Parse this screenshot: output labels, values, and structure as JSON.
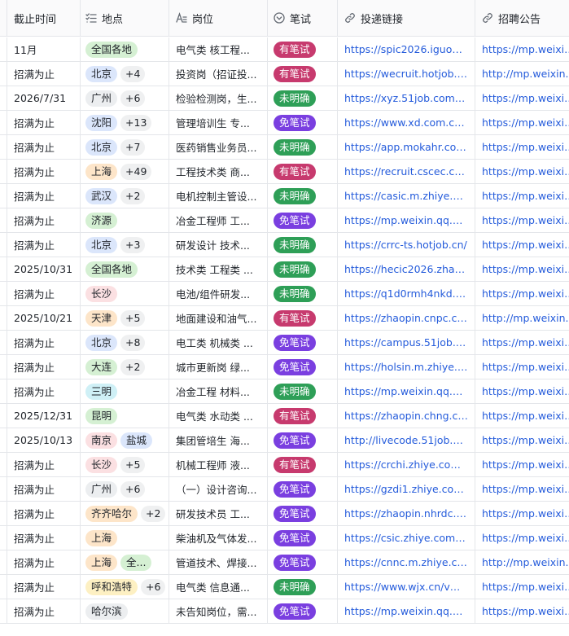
{
  "header": {
    "col_deadline": "截止时间",
    "col_location": "地点",
    "col_position": "岗位",
    "col_exam": "笔试",
    "col_apply": "投递链接",
    "col_notice": "招聘公告"
  },
  "colors": {
    "exam": {
      "有笔试": "#c73a6e",
      "未明确": "#2e9f57",
      "免笔试": "#7a3fe0"
    },
    "tags": {
      "全国各地": "#d5f0d3",
      "北京": "#dbe6fb",
      "广州": "#eceef0",
      "沈阳": "#dbe6fb",
      "上海": "#fde5c9",
      "武汉": "#dbe6fb",
      "济源": "#d5f0d3",
      "长沙": "#fbe0e2",
      "天津": "#fde5c9",
      "大连": "#d5f0d3",
      "三明": "#cff0f6",
      "昆明": "#d5f0d3",
      "南京": "#fbe0e2",
      "盐城": "#dbe6fb",
      "齐齐哈尔": "#fde5c9",
      "全...": "#d5f0d3",
      "呼和浩特": "#fdf0c3",
      "哈尔滨": "#eceef0"
    }
  },
  "rows": [
    {
      "deadline": "11月",
      "tags": [
        "全国各地"
      ],
      "more": "",
      "position": "电气类 核工程...",
      "exam": "有笔试",
      "apply": "https://spic2026.iguopin...",
      "notice": "https://mp.weixin..."
    },
    {
      "deadline": "招满为止",
      "tags": [
        "北京"
      ],
      "more": "+4",
      "position": "投资岗（招证投...",
      "exam": "有笔试",
      "apply": "https://wecruit.hotjob.c...",
      "notice": "http://mp.weixin.q..."
    },
    {
      "deadline": "2026/7/31",
      "tags": [
        "广州"
      ],
      "more": "+6",
      "position": "检验检测岗，生...",
      "exam": "未明确",
      "apply": "https://xyz.51job.com/c...",
      "notice": "https://mp.weixin..."
    },
    {
      "deadline": "招满为止",
      "tags": [
        "沈阳"
      ],
      "more": "+13",
      "position": "管理培训生 专...",
      "exam": "免笔试",
      "apply": "https://www.xd.com.cn/...",
      "notice": "https://mp.weixin..."
    },
    {
      "deadline": "招满为止",
      "tags": [
        "北京"
      ],
      "more": "+7",
      "position": "医药销售业务员...",
      "exam": "未明确",
      "apply": "https://app.mokahr.com...",
      "notice": "https://mp.weixin..."
    },
    {
      "deadline": "招满为止",
      "tags": [
        "上海"
      ],
      "more": "+49",
      "position": "工程技术类 商...",
      "exam": "有笔试",
      "apply": "https://recruit.cscec.co...",
      "notice": "https://mp.weixin..."
    },
    {
      "deadline": "招满为止",
      "tags": [
        "武汉"
      ],
      "more": "+2",
      "position": "电机控制主管设...",
      "exam": "未明确",
      "apply": "https://casic.m.zhiye.co...",
      "notice": "https://mp.weixin..."
    },
    {
      "deadline": "招满为止",
      "tags": [
        "济源"
      ],
      "more": "",
      "position": "冶金工程师 工...",
      "exam": "免笔试",
      "apply": "https://mp.weixin.qq.co...",
      "notice": "https://mp.weixin..."
    },
    {
      "deadline": "招满为止",
      "tags": [
        "北京"
      ],
      "more": "+3",
      "position": "研发设计 技术...",
      "exam": "未明确",
      "apply": "https://crrc-ts.hotjob.cn/",
      "notice": "https://mp.weixin..."
    },
    {
      "deadline": "2025/10/31",
      "tags": [
        "全国各地"
      ],
      "more": "",
      "position": "技术类 工程类 ...",
      "exam": "未明确",
      "apply": "https://hecic2026.zhaop...",
      "notice": "https://mp.weixin..."
    },
    {
      "deadline": "招满为止",
      "tags": [
        "长沙"
      ],
      "more": "",
      "position": "电池/组件研发...",
      "exam": "未明确",
      "apply": "https://q1d0rmh4nkd.fe...",
      "notice": "https://mp.weixin..."
    },
    {
      "deadline": "2025/10/21",
      "tags": [
        "天津"
      ],
      "more": "+5",
      "position": "地面建设和油气...",
      "exam": "有笔试",
      "apply": "https://zhaopin.cnpc.co...",
      "notice": "http://mp.weixin.q..."
    },
    {
      "deadline": "招满为止",
      "tags": [
        "北京"
      ],
      "more": "+8",
      "position": "电工类 机械类 ...",
      "exam": "免笔试",
      "apply": "https://campus.51job.co...",
      "notice": "https://mp.weixin..."
    },
    {
      "deadline": "招满为止",
      "tags": [
        "大连"
      ],
      "more": "+2",
      "position": "城市更新岗 绿...",
      "exam": "免笔试",
      "apply": "https://holsin.m.zhiye.c...",
      "notice": "https://mp.weixin..."
    },
    {
      "deadline": "招满为止",
      "tags": [
        "三明"
      ],
      "more": "",
      "position": "冶金工程 材料...",
      "exam": "未明确",
      "apply": "https://mp.weixin.qq.co...",
      "notice": "https://mp.weixin..."
    },
    {
      "deadline": "2025/12/31",
      "tags": [
        "昆明"
      ],
      "more": "",
      "position": "电气类 水动类 ...",
      "exam": "有笔试",
      "apply": "https://zhaopin.chng.co...",
      "notice": "https://mp.weixin..."
    },
    {
      "deadline": "2025/10/13",
      "tags": [
        "南京",
        "盐城"
      ],
      "more": "",
      "position": "集团管培生 海...",
      "exam": "免笔试",
      "apply": "http://livecode.51job.co...",
      "notice": "https://mp.weixin..."
    },
    {
      "deadline": "招满为止",
      "tags": [
        "长沙"
      ],
      "more": "+5",
      "position": "机械工程师 液...",
      "exam": "有笔试",
      "apply": "https://crchi.zhiye.com/...",
      "notice": "https://mp.weixin..."
    },
    {
      "deadline": "招满为止",
      "tags": [
        "广州"
      ],
      "more": "+6",
      "position": "（一）设计咨询...",
      "exam": "免笔试",
      "apply": "https://gzdi1.zhiye.com/...",
      "notice": "https://mp.weixin..."
    },
    {
      "deadline": "招满为止",
      "tags": [
        "齐齐哈尔"
      ],
      "more": "+2",
      "position": "研发技术员 工...",
      "exam": "免笔试",
      "apply": "https://zhaopin.nhrdc.c...",
      "notice": "https://mp.weixin..."
    },
    {
      "deadline": "招满为止",
      "tags": [
        "上海"
      ],
      "more": "",
      "position": "柴油机及气体发...",
      "exam": "免笔试",
      "apply": "https://csic.zhiye.com/c...",
      "notice": "https://mp.weixin..."
    },
    {
      "deadline": "招满为止",
      "tags": [
        "上海",
        "全..."
      ],
      "more": "",
      "position": "管道技术、焊接...",
      "exam": "免笔试",
      "apply": "https://cnnc.m.zhiye.co...",
      "notice": "http://mp.weixin.q..."
    },
    {
      "deadline": "招满为止",
      "tags": [
        "呼和浩特"
      ],
      "more": "+6",
      "position": "电气类 信息通...",
      "exam": "未明确",
      "apply": "https://www.wjx.cn/vm/...",
      "notice": "https://mp.weixin..."
    },
    {
      "deadline": "招满为止",
      "tags": [
        "哈尔滨"
      ],
      "more": "",
      "position": "未告知岗位，需...",
      "exam": "免笔试",
      "apply": "https://mp.weixin.qq.co...",
      "notice": "https://mp.weixin..."
    }
  ]
}
